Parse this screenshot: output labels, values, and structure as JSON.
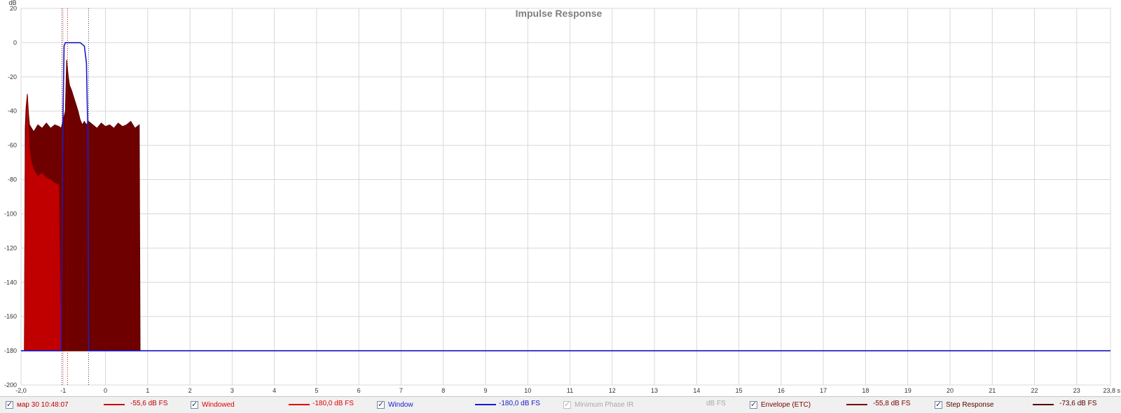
{
  "chart_data": {
    "type": "area",
    "title": "Impulse Response",
    "ylabel": "dB",
    "xunit": "s",
    "xlim": [
      -2.0,
      23.8
    ],
    "ylim": [
      -200,
      20
    ],
    "grid": true,
    "yticks": [
      "20",
      "0",
      "-20",
      "-40",
      "-60",
      "-80",
      "-100",
      "-120",
      "-140",
      "-160",
      "-180",
      "-200"
    ],
    "xticks": [
      "-2,0",
      "-1",
      "0",
      "1",
      "2",
      "3",
      "4",
      "5",
      "6",
      "7",
      "8",
      "9",
      "10",
      "11",
      "12",
      "13",
      "14",
      "15",
      "16",
      "17",
      "18",
      "19",
      "20",
      "21",
      "22",
      "23",
      "23,8 s"
    ],
    "series": [
      {
        "name": "мар 30 10:48:07",
        "color": "#cc0000",
        "x": [
          -1.92,
          -1.9,
          -1.85,
          -1.8,
          -1.75,
          -1.7,
          -1.6,
          -1.5,
          -1.4,
          -1.3,
          -1.2,
          -1.1,
          -1.05
        ],
        "y": [
          -180,
          -72,
          -30,
          -62,
          -70,
          -74,
          -78,
          -76,
          -79,
          -80,
          -82,
          -83,
          -180
        ]
      },
      {
        "name": "Windowed",
        "color": "#e00000",
        "x": [
          -2.0,
          23.8
        ],
        "y": [
          -180,
          -180
        ]
      },
      {
        "name": "Window",
        "color": "#1a1acc",
        "x": [
          -2.0,
          -1.05,
          -1.01,
          -0.98,
          -0.95,
          -0.6,
          -0.5,
          -0.45,
          -0.42,
          -0.4,
          23.8
        ],
        "y": [
          -180,
          -180,
          -50,
          -2,
          0,
          0,
          -2,
          -12,
          -50,
          -180,
          -180
        ]
      },
      {
        "name": "Envelope (ETC)",
        "color": "#7a0000",
        "x": [
          -1.92,
          -1.9,
          -1.88,
          -1.85,
          -1.82,
          -1.8,
          -1.75,
          -1.7,
          -1.6,
          -1.5,
          -1.4,
          -1.3,
          -1.2,
          -1.1,
          -1.05,
          -1.0,
          -0.95,
          -0.92,
          -0.9,
          -0.88,
          -0.85,
          -0.8,
          -0.75,
          -0.7,
          -0.65,
          -0.6,
          -0.55,
          -0.5,
          -0.45,
          -0.4,
          -0.3,
          -0.2,
          -0.1,
          0.0,
          0.1,
          0.2,
          0.3,
          0.4,
          0.5,
          0.6,
          0.7,
          0.8,
          0.82
        ],
        "y": [
          -180,
          -50,
          -38,
          -30,
          -42,
          -48,
          -50,
          -52,
          -48,
          -50,
          -47,
          -50,
          -48,
          -49,
          -50,
          -45,
          -40,
          -10,
          -15,
          -20,
          -25,
          -28,
          -32,
          -36,
          -40,
          -45,
          -48,
          -46,
          -48,
          -46,
          -48,
          -50,
          -47,
          -49,
          -48,
          -50,
          -47,
          -49,
          -48,
          -46,
          -50,
          -48,
          -180
        ]
      },
      {
        "name": "Step Response",
        "color": "#550000",
        "x": [
          -2.0,
          23.8
        ],
        "y": [
          -180,
          -180
        ]
      }
    ],
    "markers_x": [
      -1.03,
      -0.9,
      -0.4
    ]
  },
  "legend": {
    "items": [
      {
        "label": "мар 30 10:48:07",
        "level": "-55,6 dB FS",
        "label_color": "#c00000",
        "swatch": "#cc0000",
        "checked": true,
        "enabled": true
      },
      {
        "label": "Windowed",
        "level": "-180,0 dB FS",
        "label_color": "#e00000",
        "swatch": "#e00000",
        "checked": true,
        "enabled": true
      },
      {
        "label": "Window",
        "level": "-180,0 dB FS",
        "label_color": "#1a1acc",
        "swatch": "#1a1acc",
        "checked": true,
        "enabled": true
      },
      {
        "label": "Minimum Phase IR",
        "level": "dB FS",
        "label_color": "#a8a8a8",
        "swatch": "",
        "checked": true,
        "enabled": false
      },
      {
        "label": "Envelope (ETC)",
        "level": "-55,8 dB FS",
        "label_color": "#7a0000",
        "swatch": "#7a0000",
        "checked": true,
        "enabled": true
      },
      {
        "label": "Step Response",
        "level": "-73,6 dB FS",
        "label_color": "#550000",
        "swatch": "#550000",
        "checked": true,
        "enabled": true
      }
    ]
  }
}
